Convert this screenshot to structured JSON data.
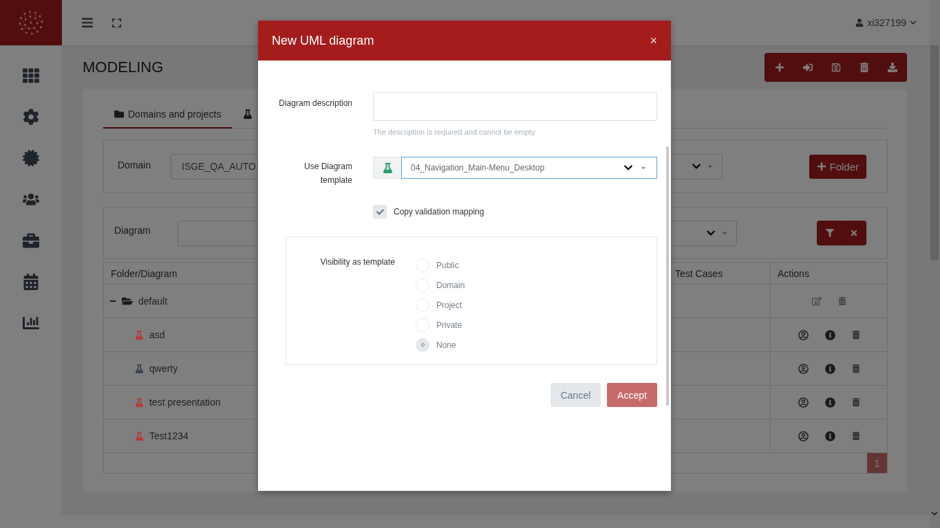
{
  "header": {
    "user": "xi327199"
  },
  "sidebar": {
    "items": [
      {
        "kind": "dashboard"
      },
      {
        "kind": "settings"
      },
      {
        "kind": "badge"
      },
      {
        "kind": "users"
      },
      {
        "kind": "briefcase"
      },
      {
        "kind": "calendar"
      },
      {
        "kind": "chart"
      }
    ]
  },
  "page": {
    "title": "MODELING"
  },
  "toolbar": [
    {
      "kind": "add"
    },
    {
      "kind": "import"
    },
    {
      "kind": "save"
    },
    {
      "kind": "delete"
    },
    {
      "kind": "download"
    }
  ],
  "tabs": [
    {
      "kind": "folder",
      "label": "Domains and projects",
      "selected": true
    },
    {
      "kind": "flask",
      "selected": false
    }
  ],
  "domain_filter": {
    "label": "Domain",
    "value": "ISGE_QA_AUTO",
    "button": "Folder"
  },
  "diagram_filter": {
    "label": "Diagram"
  },
  "table": {
    "columns": [
      "Folder/Diagram",
      "Test Cases",
      "Actions"
    ],
    "rows": [
      {
        "kind": "folder",
        "name": "default",
        "expanded": true,
        "children": [
          {
            "kind": "diagram",
            "name": "asd",
            "color": "#b83a3a"
          },
          {
            "kind": "diagram",
            "name": "qwerty",
            "color": "#3a4450"
          },
          {
            "kind": "diagram",
            "name": "test presentation",
            "color": "#b83a3a"
          },
          {
            "kind": "diagram",
            "name": "Test1234",
            "color": "#b83a3a"
          }
        ]
      }
    ]
  },
  "pagination": [
    {
      "label": "1",
      "selected": true
    }
  ],
  "dialog": {
    "title": "New UML diagram",
    "close_label": "×",
    "description": {
      "label": "Diagram description",
      "help": "The description is required and cannot be empty"
    },
    "template": {
      "label": "Use Diagram template",
      "value": "04_Navigation_Main-Menu_Desktop"
    },
    "copy_mapping": {
      "label": "Copy validation mapping",
      "checked": true
    },
    "visibility": {
      "label": "Visibility as template",
      "options": [
        {
          "label": "Public",
          "selected": false
        },
        {
          "label": "Domain",
          "selected": false
        },
        {
          "label": "Project",
          "selected": false
        },
        {
          "label": "Private",
          "selected": false
        },
        {
          "label": "None",
          "selected": true
        }
      ]
    },
    "buttons": [
      {
        "label": "Cancel",
        "kind": "secondary"
      },
      {
        "label": "Accept",
        "kind": "primary"
      }
    ]
  }
}
